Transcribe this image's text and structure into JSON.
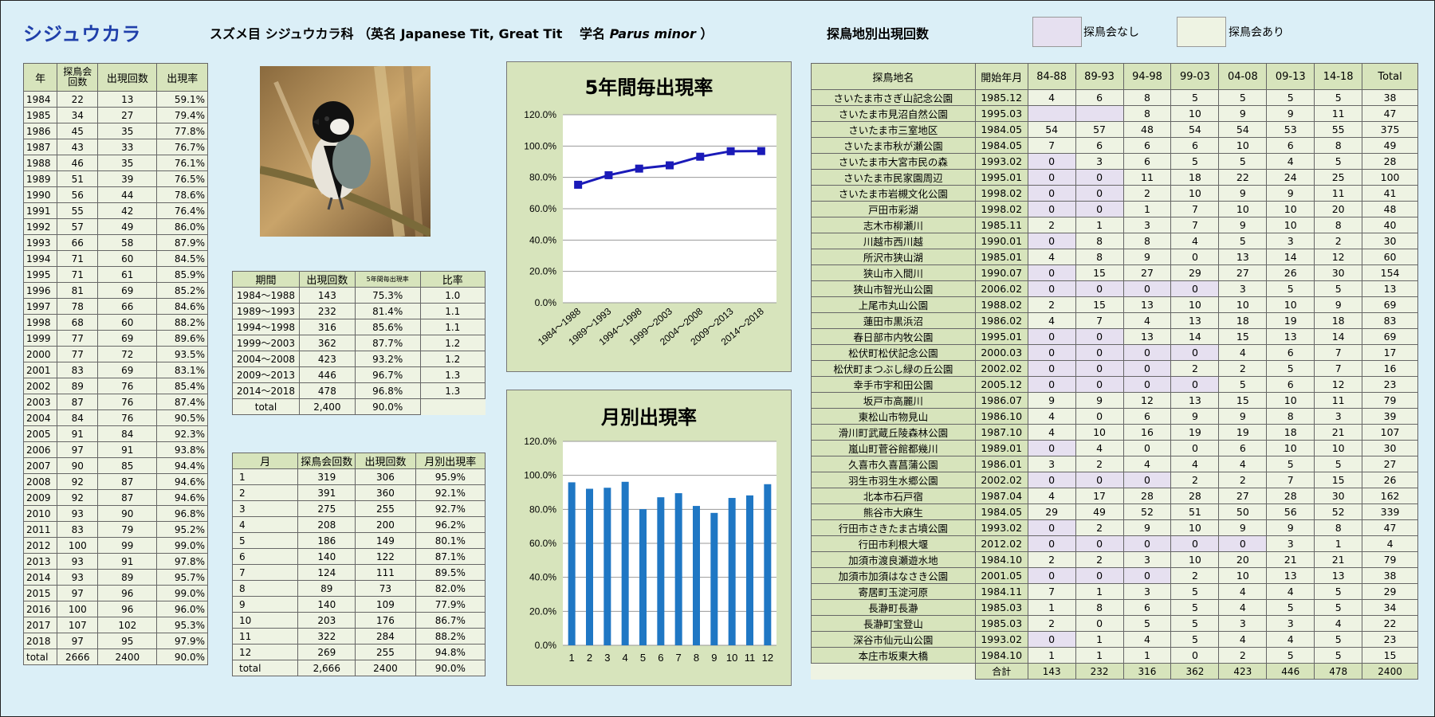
{
  "header": {
    "title": "シジュウカラ",
    "species_line": "スズメ目 シジュウカラ科 （英名 Japanese Tit, Great Tit　 学名 ",
    "scientific_name": "Parus minor",
    "species_close": "）",
    "location_title": "探鳥地別出現回数",
    "legend_none": "探鳥会なし",
    "legend_some": "探鳥会あり",
    "colors": {
      "title": "#1f3faa",
      "legend_none": "#e6e0f0",
      "legend_some": "#eef3e3",
      "header_cell": "#d7e4bc"
    }
  },
  "yearly_table": {
    "headers": [
      "年",
      "探鳥会\n回数",
      "出現回数",
      "出現率"
    ],
    "rows": [
      [
        "1984",
        "22",
        "13",
        "59.1%"
      ],
      [
        "1985",
        "34",
        "27",
        "79.4%"
      ],
      [
        "1986",
        "45",
        "35",
        "77.8%"
      ],
      [
        "1987",
        "43",
        "33",
        "76.7%"
      ],
      [
        "1988",
        "46",
        "35",
        "76.1%"
      ],
      [
        "1989",
        "51",
        "39",
        "76.5%"
      ],
      [
        "1990",
        "56",
        "44",
        "78.6%"
      ],
      [
        "1991",
        "55",
        "42",
        "76.4%"
      ],
      [
        "1992",
        "57",
        "49",
        "86.0%"
      ],
      [
        "1993",
        "66",
        "58",
        "87.9%"
      ],
      [
        "1994",
        "71",
        "60",
        "84.5%"
      ],
      [
        "1995",
        "71",
        "61",
        "85.9%"
      ],
      [
        "1996",
        "81",
        "69",
        "85.2%"
      ],
      [
        "1997",
        "78",
        "66",
        "84.6%"
      ],
      [
        "1998",
        "68",
        "60",
        "88.2%"
      ],
      [
        "1999",
        "77",
        "69",
        "89.6%"
      ],
      [
        "2000",
        "77",
        "72",
        "93.5%"
      ],
      [
        "2001",
        "83",
        "69",
        "83.1%"
      ],
      [
        "2002",
        "89",
        "76",
        "85.4%"
      ],
      [
        "2003",
        "87",
        "76",
        "87.4%"
      ],
      [
        "2004",
        "84",
        "76",
        "90.5%"
      ],
      [
        "2005",
        "91",
        "84",
        "92.3%"
      ],
      [
        "2006",
        "97",
        "91",
        "93.8%"
      ],
      [
        "2007",
        "90",
        "85",
        "94.4%"
      ],
      [
        "2008",
        "92",
        "87",
        "94.6%"
      ],
      [
        "2009",
        "92",
        "87",
        "94.6%"
      ],
      [
        "2010",
        "93",
        "90",
        "96.8%"
      ],
      [
        "2011",
        "83",
        "79",
        "95.2%"
      ],
      [
        "2012",
        "100",
        "99",
        "99.0%"
      ],
      [
        "2013",
        "93",
        "91",
        "97.8%"
      ],
      [
        "2014",
        "93",
        "89",
        "95.7%"
      ],
      [
        "2015",
        "97",
        "96",
        "99.0%"
      ],
      [
        "2016",
        "100",
        "96",
        "96.0%"
      ],
      [
        "2017",
        "107",
        "102",
        "95.3%"
      ],
      [
        "2018",
        "97",
        "95",
        "97.9%"
      ],
      [
        "total",
        "2666",
        "2400",
        "90.0%"
      ]
    ]
  },
  "period_table": {
    "headers": [
      "期間",
      "出現回数",
      "5年間毎出現率",
      "比率"
    ],
    "rows": [
      [
        "1984～1988",
        "143",
        "75.3%",
        "1.0"
      ],
      [
        "1989～1993",
        "232",
        "81.4%",
        "1.1"
      ],
      [
        "1994～1998",
        "316",
        "85.6%",
        "1.1"
      ],
      [
        "1999～2003",
        "362",
        "87.7%",
        "1.2"
      ],
      [
        "2004～2008",
        "423",
        "93.2%",
        "1.2"
      ],
      [
        "2009～2013",
        "446",
        "96.7%",
        "1.3"
      ],
      [
        "2014～2018",
        "478",
        "96.8%",
        "1.3"
      ]
    ],
    "total": [
      "total",
      "2,400",
      "90.0%"
    ]
  },
  "month_table": {
    "headers": [
      "月",
      "探鳥会回数",
      "出現回数",
      "月別出現率"
    ],
    "rows": [
      [
        "1",
        "319",
        "306",
        "95.9%"
      ],
      [
        "2",
        "391",
        "360",
        "92.1%"
      ],
      [
        "3",
        "275",
        "255",
        "92.7%"
      ],
      [
        "4",
        "208",
        "200",
        "96.2%"
      ],
      [
        "5",
        "186",
        "149",
        "80.1%"
      ],
      [
        "6",
        "140",
        "122",
        "87.1%"
      ],
      [
        "7",
        "124",
        "111",
        "89.5%"
      ],
      [
        "8",
        "89",
        "73",
        "82.0%"
      ],
      [
        "9",
        "140",
        "109",
        "77.9%"
      ],
      [
        "10",
        "203",
        "176",
        "86.7%"
      ],
      [
        "11",
        "322",
        "284",
        "88.2%"
      ],
      [
        "12",
        "269",
        "255",
        "94.8%"
      ],
      [
        "total",
        "2,666",
        "2400",
        "90.0%"
      ]
    ]
  },
  "chart_data": [
    {
      "type": "line",
      "title": "5年間毎出現率",
      "categories": [
        "1984～1988",
        "1989～1993",
        "1994～1998",
        "1999～2003",
        "2004～2008",
        "2009～2013",
        "2014～2018"
      ],
      "values": [
        75.3,
        81.4,
        85.6,
        87.7,
        93.2,
        96.7,
        96.8
      ],
      "ylim": [
        0,
        120
      ],
      "yticks": [
        "0.0%",
        "20.0%",
        "40.0%",
        "60.0%",
        "80.0%",
        "100.0%",
        "120.0%"
      ],
      "grid": true,
      "color": "#1a1ab8"
    },
    {
      "type": "bar",
      "title": "月別出現率",
      "categories": [
        "1",
        "2",
        "3",
        "4",
        "5",
        "6",
        "7",
        "8",
        "9",
        "10",
        "11",
        "12"
      ],
      "values": [
        95.9,
        92.1,
        92.7,
        96.2,
        80.1,
        87.1,
        89.5,
        82.0,
        77.9,
        86.7,
        88.2,
        94.8
      ],
      "ylim": [
        0,
        120
      ],
      "yticks": [
        "0.0%",
        "20.0%",
        "40.0%",
        "60.0%",
        "80.0%",
        "100.0%",
        "120.0%"
      ],
      "grid": true,
      "color": "#1f77c4"
    }
  ],
  "location_table": {
    "headers": [
      "探鳥地名",
      "開始年月",
      "84-88",
      "89-93",
      "94-98",
      "99-03",
      "04-08",
      "09-13",
      "14-18",
      "Total"
    ],
    "rows": [
      [
        "さいたま市さぎ山記念公園",
        "1985.12",
        "4",
        "6",
        "8",
        "5",
        "5",
        "5",
        "5",
        "38"
      ],
      [
        "さいたま市見沼自然公園",
        "1995.03",
        "",
        "",
        "8",
        "10",
        "9",
        "9",
        "11",
        "47"
      ],
      [
        "さいたま市三室地区",
        "1984.05",
        "54",
        "57",
        "48",
        "54",
        "54",
        "53",
        "55",
        "375"
      ],
      [
        "さいたま市秋が瀬公園",
        "1984.05",
        "7",
        "6",
        "6",
        "6",
        "10",
        "6",
        "8",
        "49"
      ],
      [
        "さいたま市大宮市民の森",
        "1993.02",
        "0",
        "3",
        "6",
        "5",
        "5",
        "4",
        "5",
        "28"
      ],
      [
        "さいたま市民家園周辺",
        "1995.01",
        "0",
        "0",
        "11",
        "18",
        "22",
        "24",
        "25",
        "100"
      ],
      [
        "さいたま市岩槻文化公園",
        "1998.02",
        "0",
        "0",
        "2",
        "10",
        "9",
        "9",
        "11",
        "41"
      ],
      [
        "戸田市彩湖",
        "1998.02",
        "0",
        "0",
        "1",
        "7",
        "10",
        "10",
        "20",
        "48"
      ],
      [
        "志木市柳瀬川",
        "1985.11",
        "2",
        "1",
        "3",
        "7",
        "9",
        "10",
        "8",
        "40"
      ],
      [
        "川越市西川越",
        "1990.01",
        "0",
        "8",
        "8",
        "4",
        "5",
        "3",
        "2",
        "30"
      ],
      [
        "所沢市狭山湖",
        "1985.01",
        "4",
        "8",
        "9",
        "0",
        "13",
        "14",
        "12",
        "60"
      ],
      [
        "狭山市入間川",
        "1990.07",
        "0",
        "15",
        "27",
        "29",
        "27",
        "26",
        "30",
        "154"
      ],
      [
        "狭山市智光山公園",
        "2006.02",
        "0",
        "0",
        "0",
        "0",
        "3",
        "5",
        "5",
        "13"
      ],
      [
        "上尾市丸山公園",
        "1988.02",
        "2",
        "15",
        "13",
        "10",
        "10",
        "10",
        "9",
        "69"
      ],
      [
        "蓮田市黒浜沼",
        "1986.02",
        "4",
        "7",
        "4",
        "13",
        "18",
        "19",
        "18",
        "83"
      ],
      [
        "春日部市内牧公園",
        "1995.01",
        "0",
        "0",
        "13",
        "14",
        "15",
        "13",
        "14",
        "69"
      ],
      [
        "松伏町松伏記念公園",
        "2000.03",
        "0",
        "0",
        "0",
        "0",
        "4",
        "6",
        "7",
        "17"
      ],
      [
        "松伏町まつぶし緑の丘公園",
        "2002.02",
        "0",
        "0",
        "0",
        "2",
        "2",
        "5",
        "7",
        "16"
      ],
      [
        "幸手市宇和田公園",
        "2005.12",
        "0",
        "0",
        "0",
        "0",
        "5",
        "6",
        "12",
        "23"
      ],
      [
        "坂戸市高麗川",
        "1986.07",
        "9",
        "9",
        "12",
        "13",
        "15",
        "10",
        "11",
        "79"
      ],
      [
        "東松山市物見山",
        "1986.10",
        "4",
        "0",
        "6",
        "9",
        "9",
        "8",
        "3",
        "39"
      ],
      [
        "滑川町武蔵丘陵森林公園",
        "1987.10",
        "4",
        "10",
        "16",
        "19",
        "19",
        "18",
        "21",
        "107"
      ],
      [
        "嵐山町菅谷館都幾川",
        "1989.01",
        "0",
        "4",
        "0",
        "0",
        "6",
        "10",
        "10",
        "30"
      ],
      [
        "久喜市久喜菖蒲公園",
        "1986.01",
        "3",
        "2",
        "4",
        "4",
        "4",
        "5",
        "5",
        "27"
      ],
      [
        "羽生市羽生水郷公園",
        "2002.02",
        "0",
        "0",
        "0",
        "2",
        "2",
        "7",
        "15",
        "26"
      ],
      [
        "北本市石戸宿",
        "1987.04",
        "4",
        "17",
        "28",
        "28",
        "27",
        "28",
        "30",
        "162"
      ],
      [
        "熊谷市大麻生",
        "1984.05",
        "29",
        "49",
        "52",
        "51",
        "50",
        "56",
        "52",
        "339"
      ],
      [
        "行田市さきたま古墳公園",
        "1993.02",
        "0",
        "2",
        "9",
        "10",
        "9",
        "9",
        "8",
        "47"
      ],
      [
        "行田市利根大堰",
        "2012.02",
        "0",
        "0",
        "0",
        "0",
        "0",
        "3",
        "1",
        "4"
      ],
      [
        "加須市渡良瀬遊水地",
        "1984.10",
        "2",
        "2",
        "3",
        "10",
        "20",
        "21",
        "21",
        "79"
      ],
      [
        "加須市加須はなさき公園",
        "2001.05",
        "0",
        "0",
        "0",
        "2",
        "10",
        "13",
        "13",
        "38"
      ],
      [
        "寄居町玉淀河原",
        "1984.11",
        "7",
        "1",
        "3",
        "5",
        "4",
        "4",
        "5",
        "29"
      ],
      [
        "長瀞町長瀞",
        "1985.03",
        "1",
        "8",
        "6",
        "5",
        "4",
        "5",
        "5",
        "34"
      ],
      [
        "長瀞町宝登山",
        "1985.03",
        "2",
        "0",
        "5",
        "5",
        "3",
        "3",
        "4",
        "22"
      ],
      [
        "深谷市仙元山公園",
        "1993.02",
        "0",
        "1",
        "4",
        "5",
        "4",
        "4",
        "5",
        "23"
      ],
      [
        "本庄市坂東大橋",
        "1984.10",
        "1",
        "1",
        "1",
        "0",
        "2",
        "5",
        "5",
        "15"
      ]
    ],
    "empty_cells": [
      [
        1,
        2
      ],
      [
        1,
        3
      ],
      [
        4,
        2
      ],
      [
        5,
        2
      ],
      [
        5,
        3
      ],
      [
        6,
        2
      ],
      [
        6,
        3
      ],
      [
        7,
        2
      ],
      [
        7,
        3
      ],
      [
        9,
        2
      ],
      [
        11,
        2
      ],
      [
        12,
        2
      ],
      [
        12,
        3
      ],
      [
        12,
        4
      ],
      [
        12,
        5
      ],
      [
        15,
        2
      ],
      [
        15,
        3
      ],
      [
        16,
        2
      ],
      [
        16,
        3
      ],
      [
        16,
        4
      ],
      [
        16,
        5
      ],
      [
        17,
        2
      ],
      [
        17,
        3
      ],
      [
        17,
        4
      ],
      [
        18,
        2
      ],
      [
        18,
        3
      ],
      [
        18,
        4
      ],
      [
        18,
        5
      ],
      [
        22,
        2
      ],
      [
        24,
        2
      ],
      [
        24,
        3
      ],
      [
        24,
        4
      ],
      [
        27,
        2
      ],
      [
        28,
        2
      ],
      [
        28,
        3
      ],
      [
        28,
        4
      ],
      [
        28,
        5
      ],
      [
        28,
        6
      ],
      [
        30,
        2
      ],
      [
        30,
        3
      ],
      [
        30,
        4
      ],
      [
        34,
        2
      ]
    ],
    "total_label": "合計",
    "totals": [
      "143",
      "232",
      "316",
      "362",
      "423",
      "446",
      "478",
      "2400"
    ]
  }
}
